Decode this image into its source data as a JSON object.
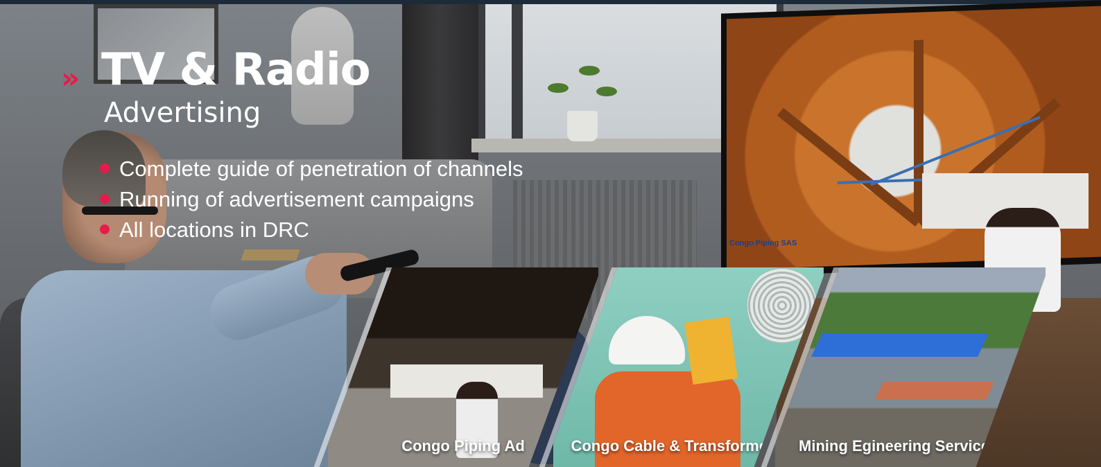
{
  "heading": {
    "chevrons": "»",
    "title": "TV & Radio",
    "subtitle": "Advertising"
  },
  "bullets": [
    "Complete guide of penetration of channels",
    "Running of advertisement campaigns",
    "All locations in DRC"
  ],
  "tv": {
    "logo": "Congo Piping SAS"
  },
  "cards": [
    {
      "label": "Congo Piping Ad"
    },
    {
      "label": "Congo Cable & Transformers Ad"
    },
    {
      "label": "Mining Egineering Services Ad"
    }
  ],
  "colors": {
    "accent": "#e51c4b",
    "text": "#ffffff"
  }
}
